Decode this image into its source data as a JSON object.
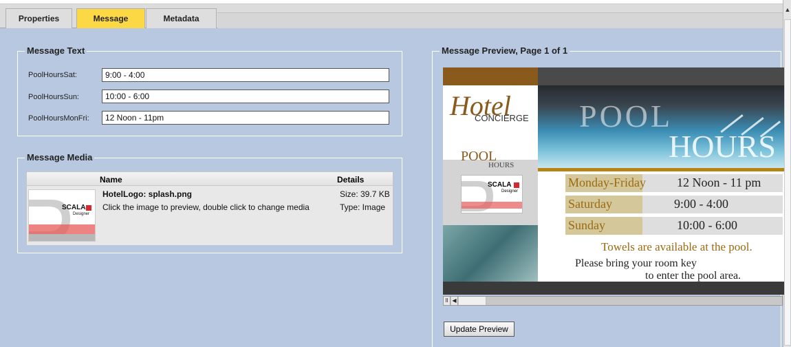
{
  "tabs": [
    {
      "label": "Properties",
      "active": false
    },
    {
      "label": "Message",
      "active": true
    },
    {
      "label": "Metadata",
      "active": false
    }
  ],
  "message_text": {
    "title": "Message Text",
    "fields": [
      {
        "label": "PoolHoursSat:",
        "value": "9:00 - 4:00"
      },
      {
        "label": "PoolHoursSun:",
        "value": "10:00 - 6:00"
      },
      {
        "label": "PoolHoursMonFri:",
        "value": "12 Noon - 11pm"
      }
    ]
  },
  "message_media": {
    "title": "Message Media",
    "columns": {
      "name": "Name",
      "details": "Details"
    },
    "item": {
      "filename": "HotelLogo: splash.png",
      "hint": "Click the image to preview, double click to change media",
      "size": "Size: 39.7 KB",
      "type": "Type: Image",
      "thumb_brand": "SCALA",
      "thumb_sub": "Designer"
    }
  },
  "preview": {
    "title": "Message Preview, Page 1 of 1",
    "hotel": "Hotel",
    "concierge": "CONCIERGE",
    "pool": "POOL",
    "hours": "HOURS",
    "banner_pool": "POOL",
    "banner_hours": "HOURS",
    "logo_brand": "SCALA",
    "logo_sub": "Designer",
    "schedule": [
      {
        "day": "Monday-Friday",
        "time": "12 Noon - 11 pm"
      },
      {
        "day": "Saturday",
        "time": "9:00 - 4:00"
      },
      {
        "day": "Sunday",
        "time": "10:00 - 6:00"
      }
    ],
    "towels": "Towels are available at the pool.",
    "key_line1": "Please bring your room key",
    "key_line2": "to enter the pool area.",
    "colors": {
      "gold": "#b78414",
      "day_text": "#9a6a12",
      "brown": "#8a5a1c"
    }
  },
  "playbar": {
    "pause": "II",
    "back": "◀"
  },
  "update_button": "Update Preview"
}
